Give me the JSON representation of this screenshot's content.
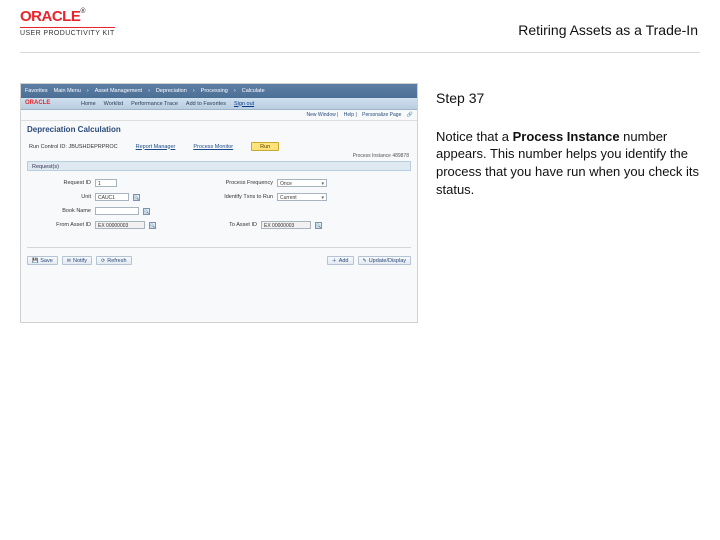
{
  "brand": {
    "name": "ORACLE",
    "tm": "®",
    "sub": "USER PRODUCTIVITY KIT"
  },
  "topic_title": "Retiring Assets as a Trade-In",
  "step": "Step 37",
  "instruction_pre": "Notice that a ",
  "instruction_bold": "Process Instance",
  "instruction_post": " number appears. This number helps you identify the process that you have run when you check its status.",
  "app": {
    "crumbs": [
      "Favorites",
      "Main Menu",
      "Asset Management",
      "Depreciation",
      "Processing",
      "Calculate"
    ],
    "tabs": [
      "Home",
      "Worklist",
      "Performance Trace",
      "Add to Favorites",
      "Sign out"
    ],
    "user_links": [
      "New Window",
      "Help",
      "Personalize Page"
    ],
    "page_title": "Depreciation Calculation",
    "runctl_label": "Run Control ID:",
    "runctl_value": "JBUSHDEPRPROC",
    "reporter_label": "Report Manager",
    "procmon_label": "Process Monitor",
    "run_btn": "Run",
    "instance_label": "Process Instance",
    "instance_value": "489878",
    "request_bar": "Request(s)",
    "fields": {
      "request_id_label": "Request ID",
      "request_id_value": "1",
      "unit_label": "Unit",
      "unit_value": "CAUC1",
      "book_name_label": "Book Name",
      "book_name_value": "",
      "process_freq_label": "Process Frequency",
      "process_freq_value": "Once",
      "txns_label": "Identify Txns to Run",
      "txns_value": "Current",
      "from_asset_label": "From Asset ID",
      "from_asset_value": "EX   00000003",
      "to_asset_label": "To Asset ID",
      "to_asset_value": "EX   00000003"
    },
    "bottom_buttons": {
      "save": "Save",
      "notify": "Notify",
      "refresh": "Refresh",
      "add": "Add",
      "update": "Update/Display"
    }
  }
}
